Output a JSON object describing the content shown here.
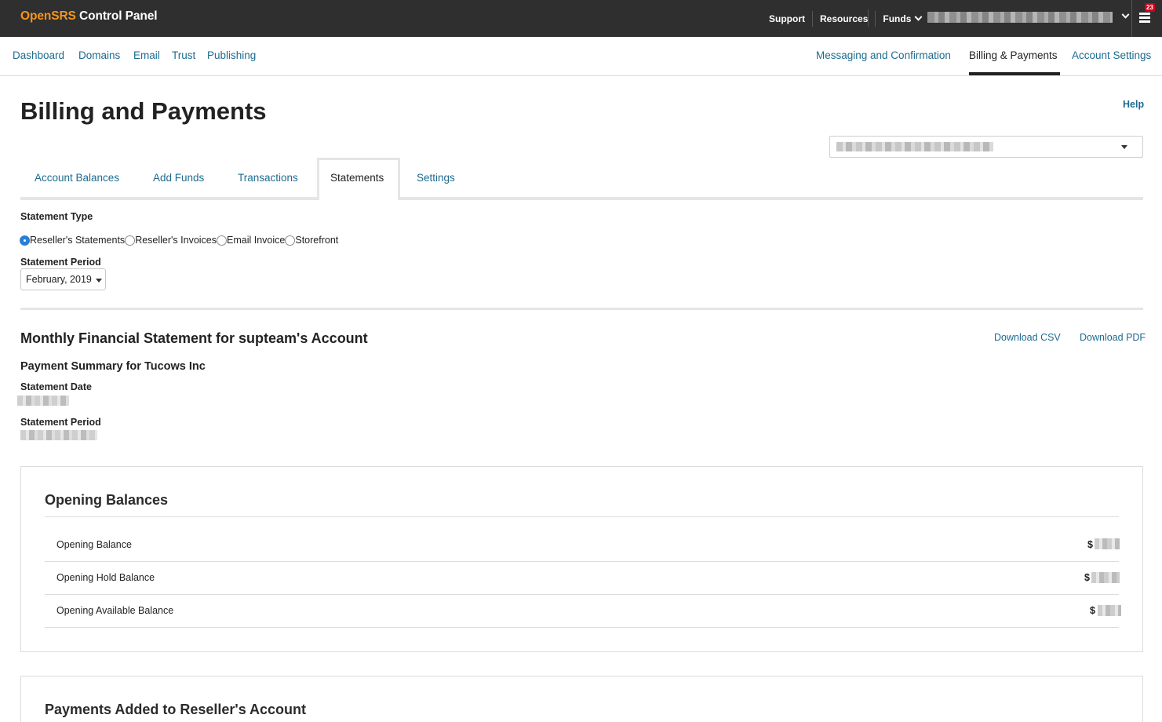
{
  "app": {
    "brand_part1": "OpenSRS",
    "brand_part2": " Control Panel"
  },
  "topnav": {
    "support": "Support",
    "resources": "Resources",
    "funds": "Funds",
    "notification_count": "23"
  },
  "subnav": {
    "left": [
      "Dashboard",
      "Domains",
      "Email",
      "Trust",
      "Publishing"
    ],
    "right": [
      "Messaging and Confirmation",
      "Billing & Payments",
      "Account Settings"
    ],
    "active": "Billing & Payments"
  },
  "page": {
    "title": "Billing and Payments",
    "help": "Help"
  },
  "tabs": {
    "items": [
      "Account Balances",
      "Add Funds",
      "Transactions",
      "Statements",
      "Settings"
    ],
    "active": "Statements"
  },
  "filters": {
    "statement_type_label": "Statement Type",
    "statement_types": [
      "Reseller's Statements",
      "Reseller's Invoices",
      "Email Invoice",
      "Storefront"
    ],
    "selected_type": "Reseller's Statements",
    "statement_period_label": "Statement Period",
    "statement_period_value": "February, 2019"
  },
  "statement": {
    "title": "Monthly Financial Statement for supteam's Account",
    "download_csv": "Download CSV",
    "download_pdf": "Download PDF",
    "payment_summary": "Payment Summary for Tucows Inc",
    "date_label": "Statement Date",
    "period_label": "Statement Period"
  },
  "opening_balances": {
    "title": "Opening Balances",
    "rows": [
      {
        "label": "Opening Balance",
        "currency": "$"
      },
      {
        "label": "Opening Hold Balance",
        "currency": "$"
      },
      {
        "label": "Opening Available Balance",
        "currency": "$"
      }
    ]
  },
  "payments_added": {
    "title": "Payments Added to Reseller's Account"
  },
  "colors": {
    "topbar": "#2f2f2f",
    "brand_accent": "#f7941d",
    "link": "#1d6b8f",
    "radio_selected": "#2a7fd4",
    "badge": "#d0021b"
  }
}
